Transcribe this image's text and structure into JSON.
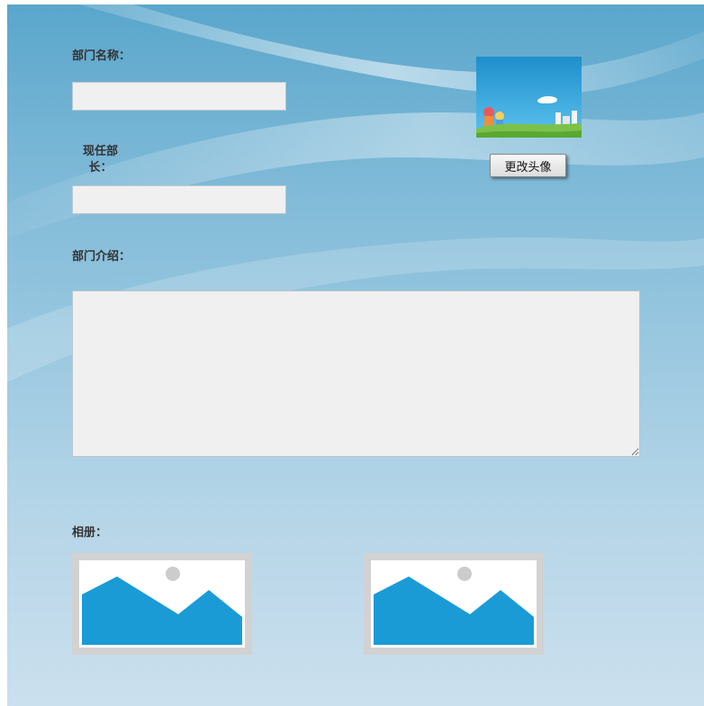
{
  "form": {
    "department_name_label": "部门名称：",
    "department_name_value": "",
    "current_head_label_line1": "现任部",
    "current_head_label_line2": "长：",
    "current_head_value": "",
    "department_intro_label": "部门介绍：",
    "department_intro_value": "",
    "change_avatar_button": "更改头像",
    "album_label": "相册："
  },
  "album": {
    "photos": [
      "image-placeholder-icon",
      "image-placeholder-icon"
    ]
  },
  "colors": {
    "placeholder_blue": "#1a9bd6",
    "placeholder_frame": "#d2d2d2",
    "input_bg": "#f0f0f0"
  }
}
